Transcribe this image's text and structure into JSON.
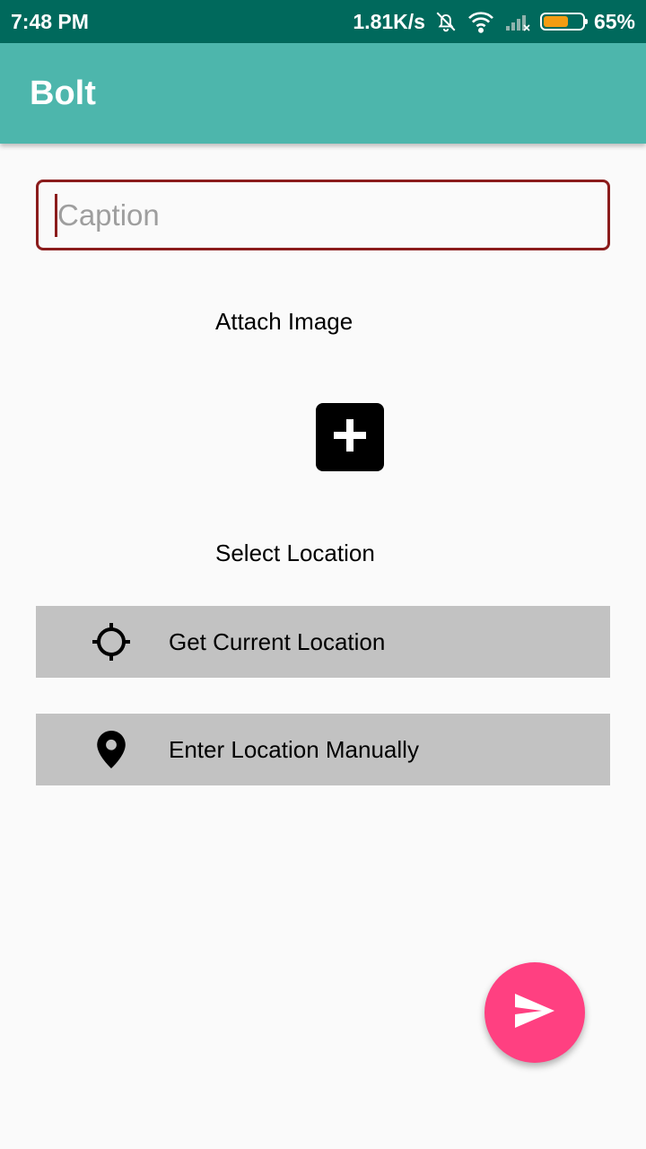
{
  "status_bar": {
    "time": "7:48 PM",
    "network_speed": "1.81K/s",
    "battery_percent": "65%",
    "battery_level": 0.65,
    "battery_color": "#f39c12",
    "icons": [
      "mute-bell-icon",
      "wifi-icon",
      "signal-icon",
      "battery-icon"
    ]
  },
  "app_bar": {
    "title": "Bolt",
    "color": "#4db6ac"
  },
  "form": {
    "caption_placeholder": "Caption",
    "caption_value": "",
    "attach_image_label": "Attach Image",
    "add_image_icon": "add-box-icon",
    "select_location_label": "Select Location",
    "get_current_location_label": "Get Current Location",
    "get_current_location_icon": "crosshair-icon",
    "enter_location_manually_label": "Enter Location Manually",
    "enter_location_manually_icon": "map-pin-icon"
  },
  "fab": {
    "icon": "send-icon",
    "color": "#ff4081"
  }
}
